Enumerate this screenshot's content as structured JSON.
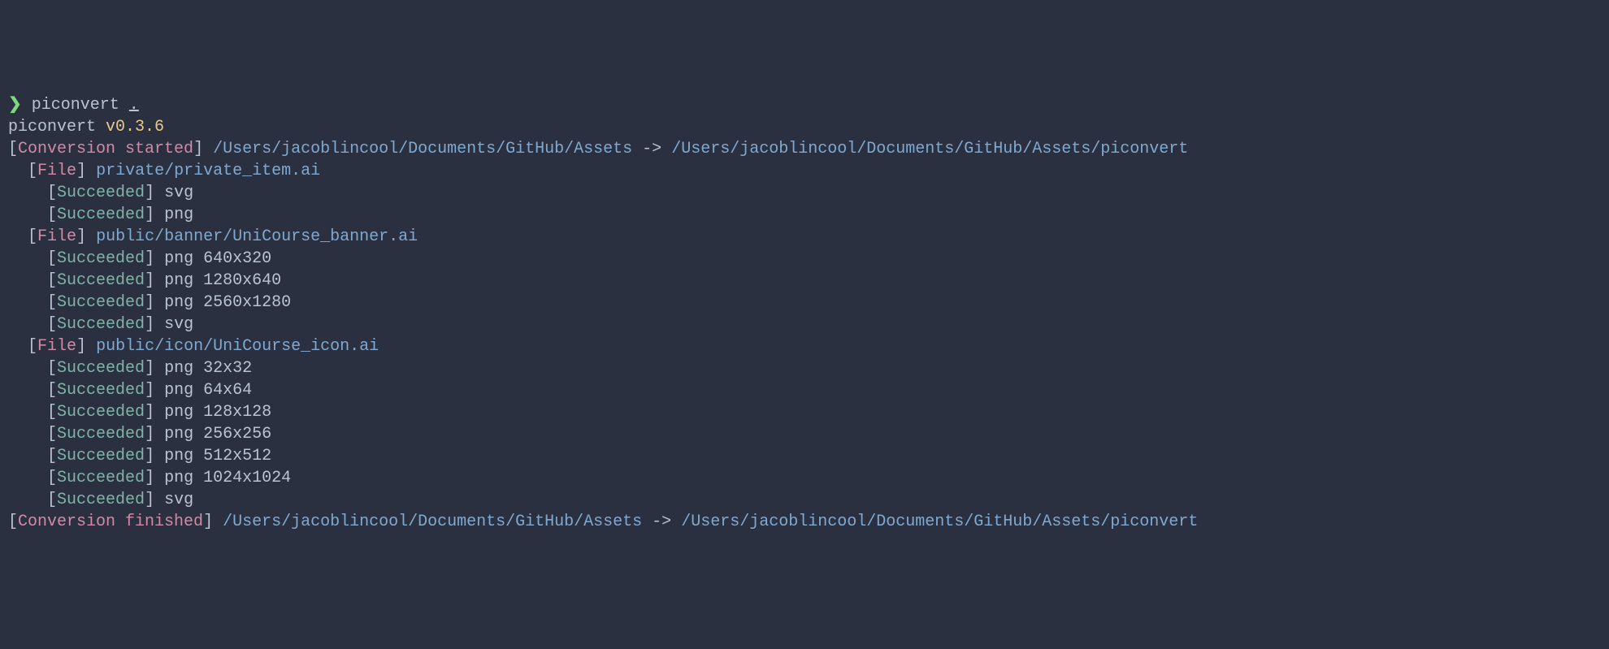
{
  "prompt": {
    "symbol": "❯",
    "command": "piconvert",
    "arg": "."
  },
  "header": {
    "program": "piconvert",
    "version": "v0.3.6"
  },
  "conversion": {
    "started_label": "Conversion started",
    "finished_label": "Conversion finished",
    "src_path": "/Users/jacoblincool/Documents/GitHub/Assets",
    "arrow": "->",
    "dst_path": "/Users/jacoblincool/Documents/GitHub/Assets/piconvert"
  },
  "file_label": "File",
  "succeeded_label": "Succeeded",
  "files": [
    {
      "path": "private/private_item.ai",
      "outputs": [
        "svg",
        "png"
      ]
    },
    {
      "path": "public/banner/UniCourse_banner.ai",
      "outputs": [
        "png 640x320",
        "png 1280x640",
        "png 2560x1280",
        "svg"
      ]
    },
    {
      "path": "public/icon/UniCourse_icon.ai",
      "outputs": [
        "png 32x32",
        "png 64x64",
        "png 128x128",
        "png 256x256",
        "png 512x512",
        "png 1024x1024",
        "svg"
      ]
    }
  ]
}
